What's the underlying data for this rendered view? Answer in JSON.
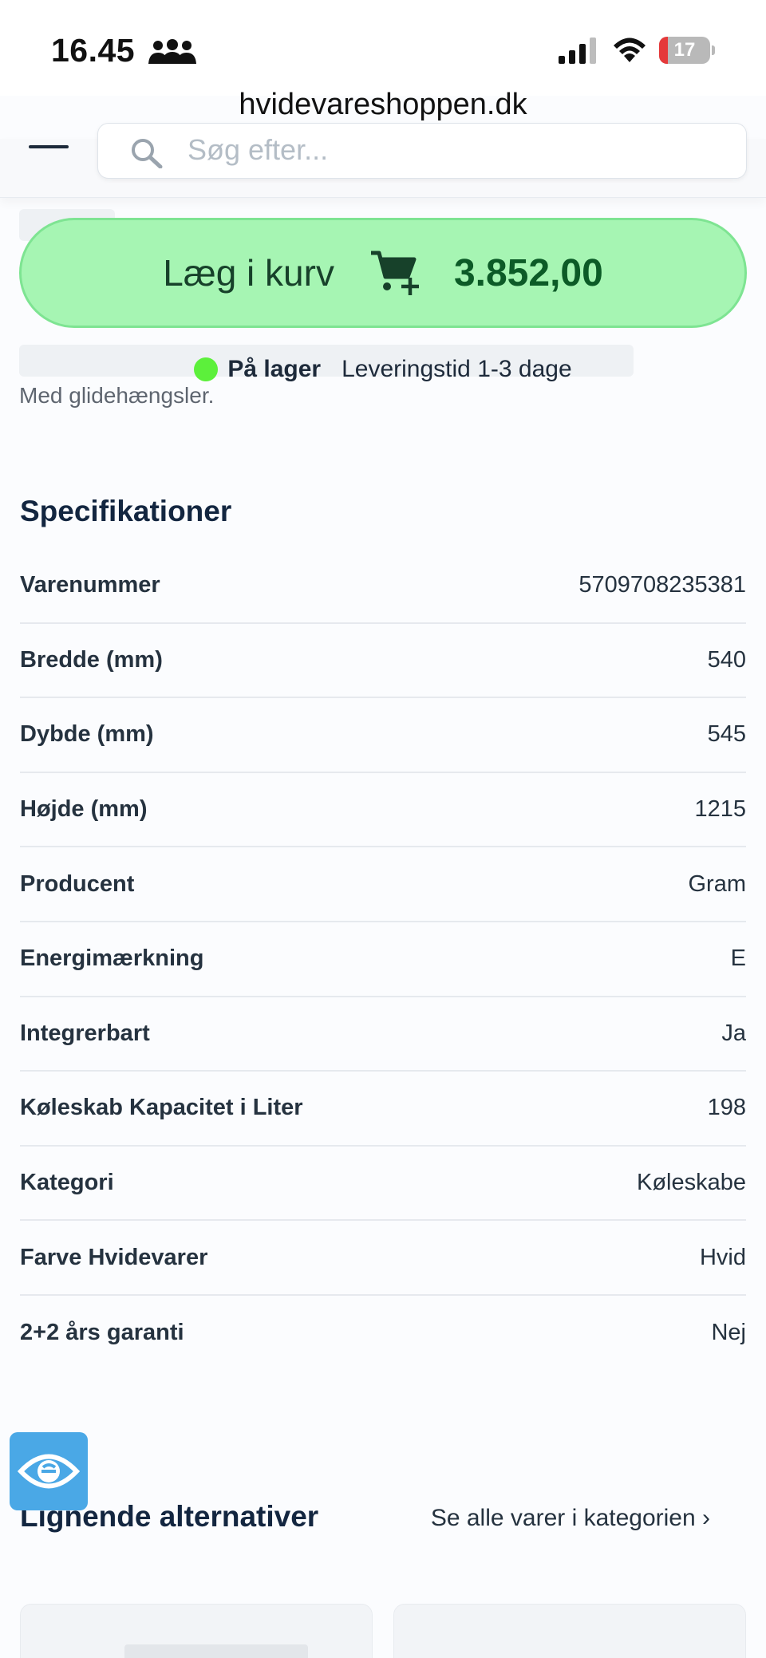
{
  "status_bar": {
    "time": "16.45",
    "battery_percent": "17",
    "battery_level": 0.17,
    "icons": [
      "people-icon",
      "signal-icon",
      "wifi-icon",
      "battery-icon"
    ]
  },
  "browser": {
    "url": "hvidevareshoppen.dk"
  },
  "header": {
    "search_placeholder": "Søg efter..."
  },
  "partial_text": "Med glidehængsler.",
  "product": {
    "add_to_cart_label": "Læg i kurv",
    "price": "3.852,00",
    "stock_status": "På lager",
    "delivery_time": "Leveringstid 1-3 dage"
  },
  "specs": {
    "title": "Specifikationer",
    "rows": [
      {
        "label": "Varenummer",
        "value": "5709708235381"
      },
      {
        "label": "Bredde (mm)",
        "value": "540"
      },
      {
        "label": "Dybde (mm)",
        "value": "545"
      },
      {
        "label": "Højde (mm)",
        "value": "1215"
      },
      {
        "label": "Producent",
        "value": "Gram"
      },
      {
        "label": "Energimærkning",
        "value": "E"
      },
      {
        "label": "Integrerbart",
        "value": "Ja"
      },
      {
        "label": "Køleskab Kapacitet i Liter",
        "value": "198"
      },
      {
        "label": "Kategori",
        "value": "Køleskabe"
      },
      {
        "label": "Farve Hvidevarer",
        "value": "Hvid"
      },
      {
        "label": "2+2 års garanti",
        "value": "Nej"
      }
    ]
  },
  "alternatives": {
    "title": "Lignende alternativer",
    "link_label": "Se alle varer i kategorien ›"
  },
  "colors": {
    "cart_button": "#a6f5b3",
    "price": "#0c5b27",
    "stock_dot": "#5cf03b",
    "accessibility_button": "#4aa8e6"
  }
}
